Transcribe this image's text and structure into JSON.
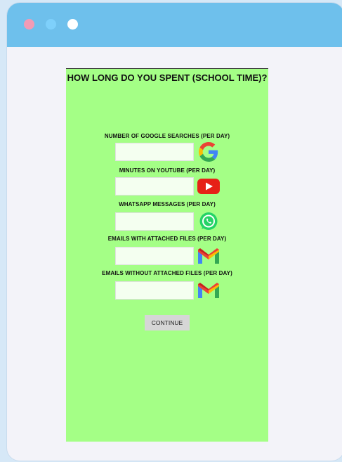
{
  "form": {
    "title": "HOW LONG DO YOU SPENT (SCHOOL TIME)?",
    "fields": [
      {
        "label": "NUMBER OF GOOGLE SEARCHES (PER DAY)",
        "value": "",
        "icon": "google-icon"
      },
      {
        "label": "MINUTES ON YOUTUBE (PER DAY)",
        "value": "",
        "icon": "youtube-icon"
      },
      {
        "label": "WHATSAPP MESSAGES (PER DAY)",
        "value": "",
        "icon": "whatsapp-icon"
      },
      {
        "label": "EMAILS WITH ATTACHED FILES (PER DAY)",
        "value": "",
        "icon": "gmail-icon"
      },
      {
        "label": "EMAILS WITHOUT ATTACHED FILES (PER DAY)",
        "value": "",
        "icon": "gmail-icon"
      }
    ],
    "continue_label": "CONTINUE"
  },
  "colors": {
    "titlebar": "#6ec0ec",
    "form_background": "#a4ff86",
    "button": "#d6d6d6"
  }
}
